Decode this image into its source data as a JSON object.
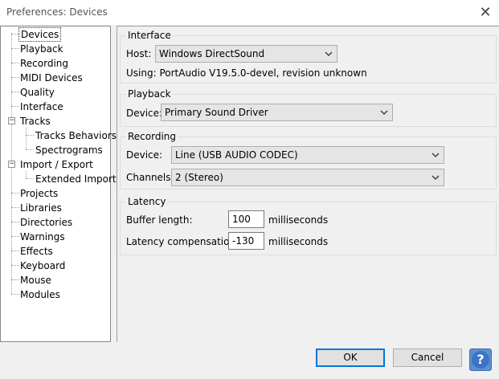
{
  "window": {
    "title": "Preferences: Devices",
    "close_glyph": "✕"
  },
  "tree": {
    "items": [
      {
        "label": "Devices"
      },
      {
        "label": "Playback"
      },
      {
        "label": "Recording"
      },
      {
        "label": "MIDI Devices"
      },
      {
        "label": "Quality"
      },
      {
        "label": "Interface"
      },
      {
        "label": "Tracks"
      },
      {
        "label": "Tracks Behaviors"
      },
      {
        "label": "Spectrograms"
      },
      {
        "label": "Import / Export"
      },
      {
        "label": "Extended Import"
      },
      {
        "label": "Projects"
      },
      {
        "label": "Libraries"
      },
      {
        "label": "Directories"
      },
      {
        "label": "Warnings"
      },
      {
        "label": "Effects"
      },
      {
        "label": "Keyboard"
      },
      {
        "label": "Mouse"
      },
      {
        "label": "Modules"
      }
    ],
    "collapse_glyph": "−"
  },
  "interface": {
    "title": "Interface",
    "host_label": "Host:",
    "host_value": "Windows DirectSound",
    "using_text": "Using: PortAudio V19.5.0-devel, revision unknown"
  },
  "playback": {
    "title": "Playback",
    "device_label": "Device:",
    "device_value": "Primary Sound Driver"
  },
  "recording": {
    "title": "Recording",
    "device_label": "Device:",
    "device_value": "Line (USB AUDIO  CODEC)",
    "channels_label": "Channels:",
    "channels_value": "2 (Stereo)"
  },
  "latency": {
    "title": "Latency",
    "buffer_label": "Buffer length:",
    "buffer_value": "100",
    "buffer_unit": "milliseconds",
    "compensation_label": "Latency compensation:",
    "compensation_value": "-130",
    "compensation_unit": "milliseconds"
  },
  "buttons": {
    "ok": "OK",
    "cancel": "Cancel",
    "help": "?"
  },
  "colors": {
    "accent": "#0078d7",
    "help_blue": "#3b74c4"
  }
}
